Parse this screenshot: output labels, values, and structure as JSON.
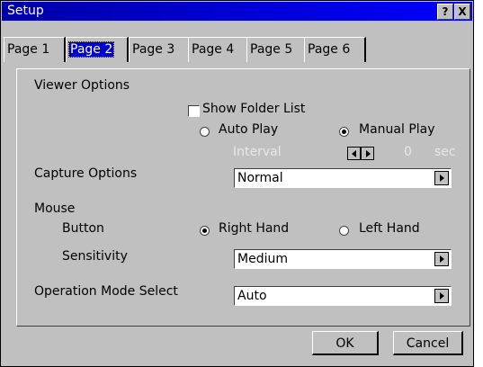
{
  "window": {
    "title": "Setup"
  },
  "titlebar": {
    "help_label": "?",
    "close_label": "X"
  },
  "tabs": [
    {
      "label": "Page 1"
    },
    {
      "label": "Page 2"
    },
    {
      "label": "Page 3"
    },
    {
      "label": "Page 4"
    },
    {
      "label": "Page 5"
    },
    {
      "label": "Page 6"
    }
  ],
  "active_tab": "Page 2",
  "viewer": {
    "heading": "Viewer Options",
    "show_folder_list": {
      "label": "Show Folder List",
      "checked": false
    },
    "auto_play": {
      "label": "Auto Play",
      "selected": false
    },
    "manual_play": {
      "label": "Manual Play",
      "selected": true
    },
    "interval_label": "Interval",
    "interval_value": "0",
    "interval_unit": "sec"
  },
  "capture": {
    "label": "Capture Options",
    "value": "Normal"
  },
  "mouse": {
    "heading": "Mouse",
    "button_label": "Button",
    "right_hand": {
      "label": "Right Hand",
      "selected": true
    },
    "left_hand": {
      "label": "Left Hand",
      "selected": false
    },
    "sensitivity_label": "Sensitivity",
    "sensitivity_value": "Medium"
  },
  "operation": {
    "label": "Operation Mode Select",
    "value": "Auto"
  },
  "buttons": {
    "ok": "OK",
    "cancel": "Cancel"
  }
}
